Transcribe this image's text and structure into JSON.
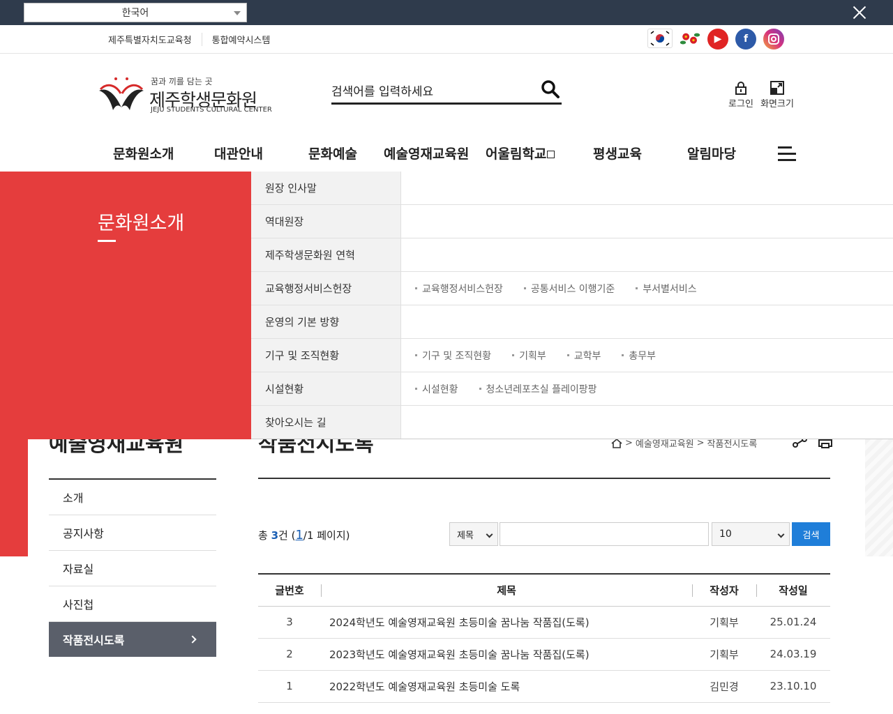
{
  "topbar": {
    "language": "한국어"
  },
  "util": {
    "links": [
      "제주특별자치도교육청",
      "통합예약시스템"
    ],
    "social": {
      "youtube": "▶",
      "facebook": "f"
    }
  },
  "header": {
    "logo_small": "꿈과 끼를 담는 곳",
    "logo_name": "제주학생문화원",
    "logo_en": "JEJU STUDENTS CULTURAL CENTER",
    "search_placeholder": "검색어를 입력하세요",
    "login": "로그인",
    "screen_size": "화면크기"
  },
  "gnb": [
    "문화원소개",
    "대관안내",
    "문화예술",
    "예술영재교육원",
    "어울림학교",
    "평생교육",
    "알림마당"
  ],
  "mega": {
    "title": "문화원소개",
    "rows": [
      {
        "label": "원장 인사말",
        "subs": []
      },
      {
        "label": "역대원장",
        "subs": []
      },
      {
        "label": "제주학생문화원 연혁",
        "subs": []
      },
      {
        "label": "교육행정서비스헌장",
        "subs": [
          "교육행정서비스헌장",
          "공통서비스 이행기준",
          "부서별서비스"
        ]
      },
      {
        "label": "운영의 기본 방향",
        "subs": []
      },
      {
        "label": "기구 및 조직현황",
        "subs": [
          "기구 및 조직현황",
          "기획부",
          "교학부",
          "총무부"
        ]
      },
      {
        "label": "시설현황",
        "subs": [
          "시설현황",
          "청소년레포츠실 플레이팡팡"
        ]
      },
      {
        "label": "찾아오시는 길",
        "subs": []
      }
    ]
  },
  "page": {
    "lnb_title": "예술영재교육원",
    "content_title": "작품전시도록",
    "breadcrumb": [
      "예술영재교육원",
      "작품전시도록"
    ],
    "lnb_items": [
      "소개",
      "공지사항",
      "자료실",
      "사진첩",
      "작품전시도록"
    ]
  },
  "board": {
    "total_prefix": "총 ",
    "total_count": "3",
    "total_mid": "건 (",
    "current_page": "1",
    "total_suffix": "/1 페이지)",
    "field_select": "제목",
    "count_select": "10",
    "search_button": "검색",
    "headers": [
      "글번호",
      "제목",
      "작성자",
      "작성일"
    ],
    "rows": [
      {
        "no": "3",
        "title": "2024학년도 예술영재교육원 초등미술 꿈나눔 작품집(도록)",
        "author": "기획부",
        "date": "25.01.24"
      },
      {
        "no": "2",
        "title": "2023학년도 예술영재교육원 초등미술 꿈나눔 작품집(도록)",
        "author": "기획부",
        "date": "24.03.19"
      },
      {
        "no": "1",
        "title": "2022학년도 예술영재교육원 초등미술 도록",
        "author": "김민경",
        "date": "23.10.10"
      }
    ]
  }
}
